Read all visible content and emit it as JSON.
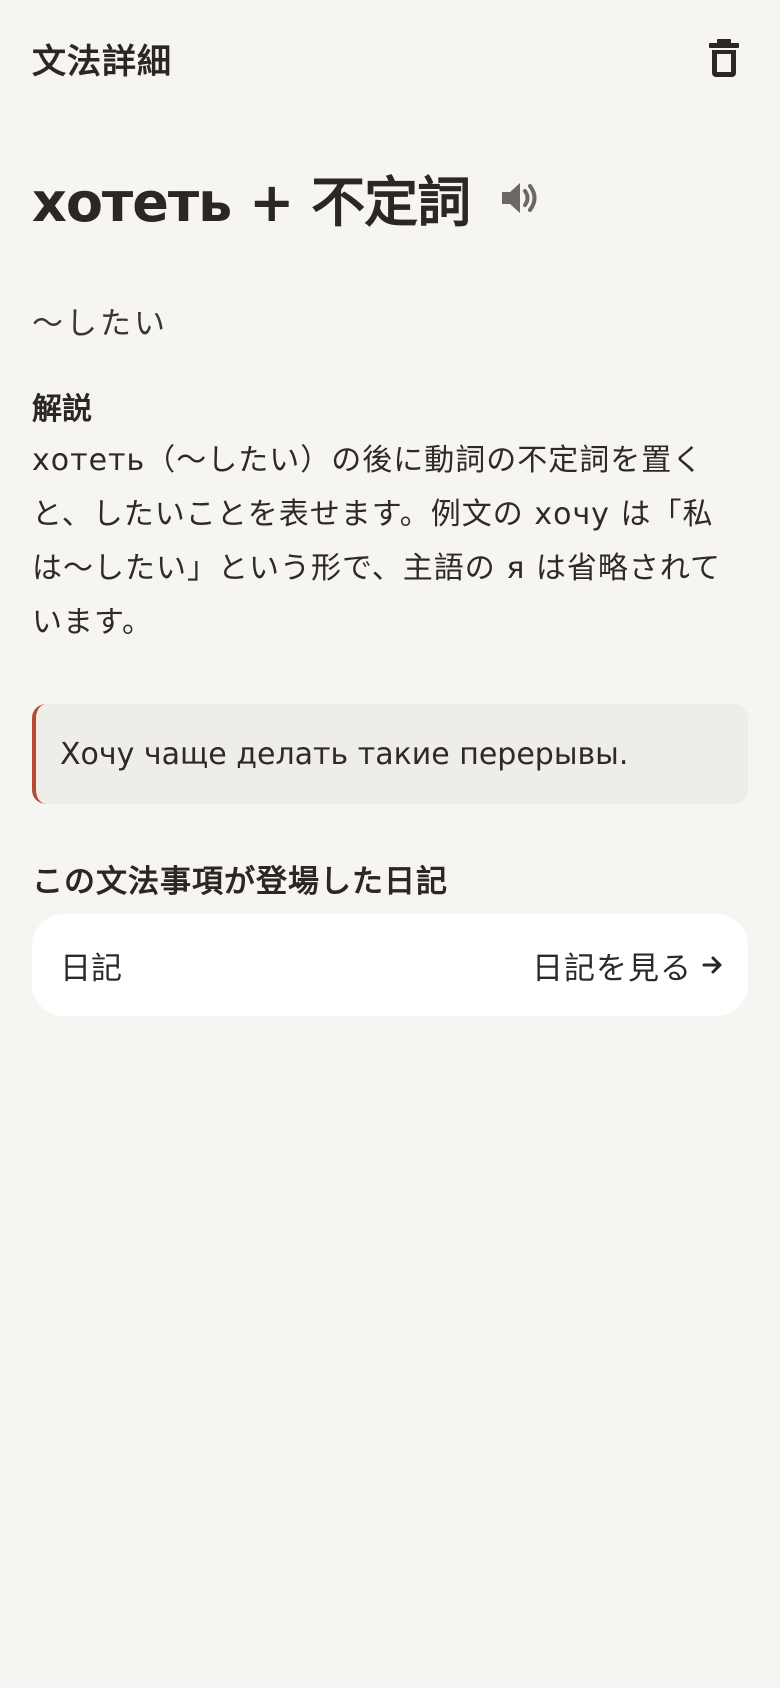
{
  "header": {
    "title": "文法詳細",
    "delete_icon": "trash-icon"
  },
  "grammar": {
    "title": "хотеть + 不定詞",
    "audio_icon": "speaker-icon",
    "meaning": "〜したい"
  },
  "explanation": {
    "label": "解説",
    "text": "хотеть（〜したい）の後に動詞の不定詞を置くと、したいことを表せます。例文の хочу は「私は〜したい」という形で、主語の я は省略されています。"
  },
  "example": {
    "sentence": "Хочу чаще делать такие перерывы.",
    "accent_color": "#b84a33"
  },
  "appearances": {
    "heading": "この文法事項が登場した日記",
    "items": [
      {
        "name": "日記",
        "link_label": "日記を見る",
        "link_icon": "arrow-right-icon"
      }
    ]
  },
  "colors": {
    "background": "#f6f5f2",
    "card": "#ffffff",
    "example_bg": "#efede8",
    "text": "#2a2725"
  }
}
